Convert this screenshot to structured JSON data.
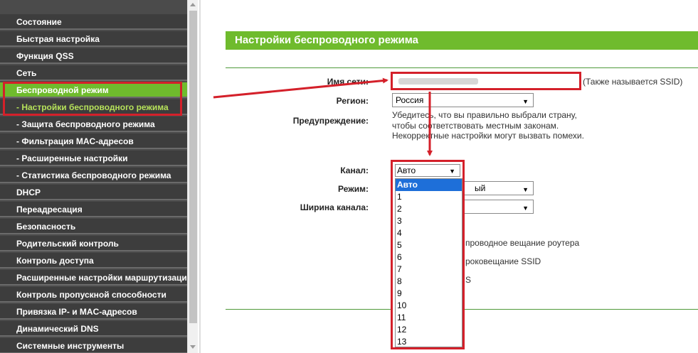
{
  "sidebar": {
    "items": [
      {
        "label": "Состояние"
      },
      {
        "label": "Быстрая настройка"
      },
      {
        "label": "Функция QSS"
      },
      {
        "label": "Сеть"
      },
      {
        "label": "Беспроводной режим"
      },
      {
        "label": "- Настройки беспроводного режима"
      },
      {
        "label": "- Защита беспроводного режима"
      },
      {
        "label": "- Фильтрация MAC-адресов"
      },
      {
        "label": "- Расширенные настройки"
      },
      {
        "label": "- Статистика беспроводного режима"
      },
      {
        "label": "DHCP"
      },
      {
        "label": "Переадресация"
      },
      {
        "label": "Безопасность"
      },
      {
        "label": "Родительский контроль"
      },
      {
        "label": "Контроль доступа"
      },
      {
        "label": "Расширенные настройки маршрутизации"
      },
      {
        "label": "Контроль пропускной способности"
      },
      {
        "label": "Привязка IP- и MAC-адресов"
      },
      {
        "label": "Динамический DNS"
      },
      {
        "label": "Системные инструменты"
      }
    ]
  },
  "main": {
    "header": "Настройки беспроводного режима",
    "ssid_label": "Имя сети:",
    "ssid_hint": "(Также называется SSID)",
    "region_label": "Регион:",
    "region_value": "Россия",
    "warning_label": "Предупреждение:",
    "warning_lines": [
      "Убедитесь, что вы правильно выбрали страну,",
      "чтобы соответствовать местным законам.",
      "Некорректные настройки могут вызвать помехи."
    ],
    "channel_label": "Канал:",
    "channel_value": "Авто",
    "mode_label": "Режим:",
    "mode_value_partial": "ый",
    "width_label": "Ширина канала:",
    "opt_broadcast": "проводное вещание роутера",
    "opt_ssid": "роковещание SSID",
    "opt_wds": "S"
  },
  "channel_options": [
    "Авто",
    "1",
    "2",
    "3",
    "4",
    "5",
    "6",
    "7",
    "8",
    "9",
    "10",
    "11",
    "12",
    "13"
  ],
  "colors": {
    "accent_green": "#6fbb2d",
    "highlight_red": "#d4202a",
    "sidebar_bg": "#3d3d3d",
    "selection_blue": "#1e6fd9"
  }
}
